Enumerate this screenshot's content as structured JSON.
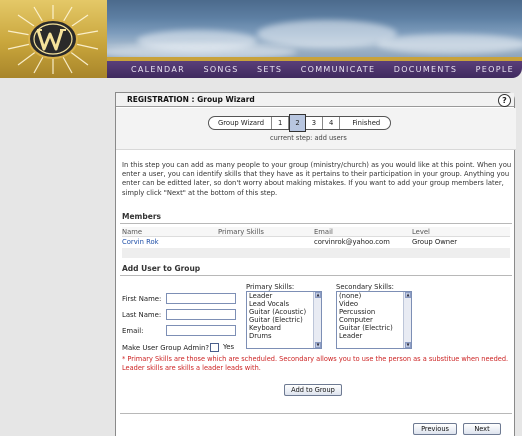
{
  "nav": {
    "items": [
      "CALENDAR",
      "SONGS",
      "SETS",
      "COMMUNICATE",
      "DOCUMENTS",
      "PEOPLE"
    ]
  },
  "panel": {
    "title": "REGISTRATION : Group Wizard",
    "help": "?"
  },
  "wizard": {
    "steps": [
      "Group Wizard",
      "1",
      "2",
      "3",
      "4",
      "Finished"
    ],
    "active_step": "2",
    "current_step_text": "current step: add users"
  },
  "intro": "In this step you can add as many people to your group (ministry/church) as you would like at this point. When you enter a user, you can identify skills that they have as it pertains to their participation in your group. Anything you enter can be editted later, so don't worry about making mistakes. If you want to add your group members later, simply click \"Next\" at the bottom of this step.",
  "members": {
    "title": "Members",
    "columns": [
      "Name",
      "Primary Skills",
      "Email",
      "Level"
    ],
    "rows": [
      {
        "name": "Corvin Rok",
        "skills": "",
        "email": "corvinrok@yahoo.com",
        "level": "Group Owner"
      }
    ]
  },
  "add_user": {
    "title": "Add User to Group",
    "first_name_label": "First Name:",
    "last_name_label": "Last Name:",
    "email_label": "Email:",
    "admin_label": "Make User Group Admin?",
    "admin_yes": "Yes",
    "primary_skills_label": "Primary Skills:",
    "primary_skills": [
      "Leader",
      "Lead Vocals",
      "Guitar (Acoustic)",
      "Guitar (Electric)",
      "Keyboard",
      "Drums"
    ],
    "secondary_skills_label": "Secondary Skills:",
    "secondary_skills": [
      "(none)",
      "Video",
      "Percussion",
      "Computer",
      "Guitar (Electric)",
      "Leader"
    ],
    "note": "* Primary Skills are those which are scheduled. Secondary allows you to use the person as a substitue when needed. Leader skills are skills a leader leads with.",
    "add_button": "Add to Group"
  },
  "footer": {
    "previous": "Previous",
    "next": "Next"
  },
  "colors": {
    "nav_bg": "#4a3268",
    "gold": "#c8a23b",
    "link": "#1f4fa8",
    "note": "#cc2222",
    "active_step": "#b8c6e0"
  }
}
